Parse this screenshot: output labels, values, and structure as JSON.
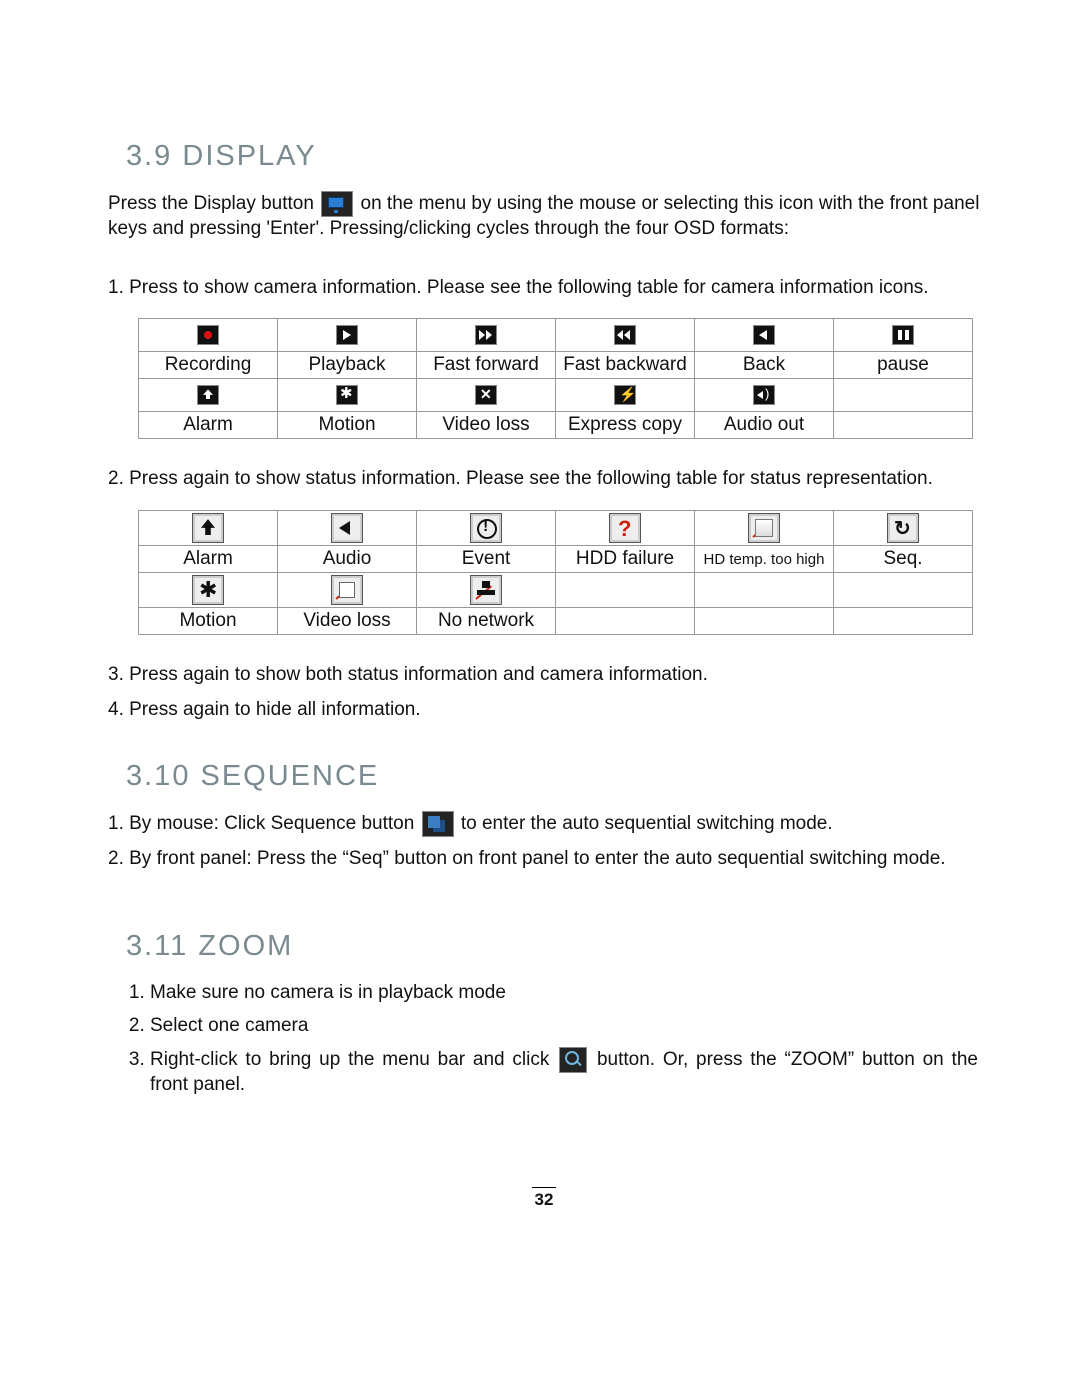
{
  "sections": {
    "display": {
      "heading": "3.9  DISPLAY",
      "p1a": "Press the Display button ",
      "p1b": " on the menu by using the mouse or selecting this icon with the front panel keys and pressing 'Enter'.  Pressing/clicking cycles through the four OSD formats:",
      "p2": "1. Press to show camera information. Please see the following table for camera information icons.",
      "table1": {
        "row1": [
          "Recording",
          "Playback",
          "Fast forward",
          "Fast backward",
          "Back",
          "pause"
        ],
        "row2": [
          "Alarm",
          "Motion",
          "Video loss",
          "Express copy",
          "Audio out",
          ""
        ]
      },
      "p3": "2. Press again to show status information. Please see the following table for status representation.",
      "table2": {
        "row1": [
          "Alarm",
          "Audio",
          "Event",
          "HDD failure",
          "HD temp. too high",
          "Seq."
        ],
        "row2": [
          "Motion",
          "Video loss",
          "No network",
          "",
          "",
          ""
        ]
      },
      "p4": "3. Press again to show both status information and camera information.",
      "p5": "4. Press again to hide all information."
    },
    "sequence": {
      "heading": "3.10 SEQUENCE",
      "l1a": "1. By mouse: Click Sequence button ",
      "l1b": " to enter the auto sequential switching mode.",
      "l2": "2. By front panel: Press the “Seq” button on front panel to enter the auto sequential switching mode."
    },
    "zoom": {
      "heading": "3.11 ZOOM",
      "items": [
        "Make sure no camera is in playback mode",
        "Select one camera"
      ],
      "item3a": "Right-click to bring up the menu bar and click ",
      "item3b": " button. Or, press the “ZOOM” button on the front panel."
    }
  },
  "page_number": "32"
}
